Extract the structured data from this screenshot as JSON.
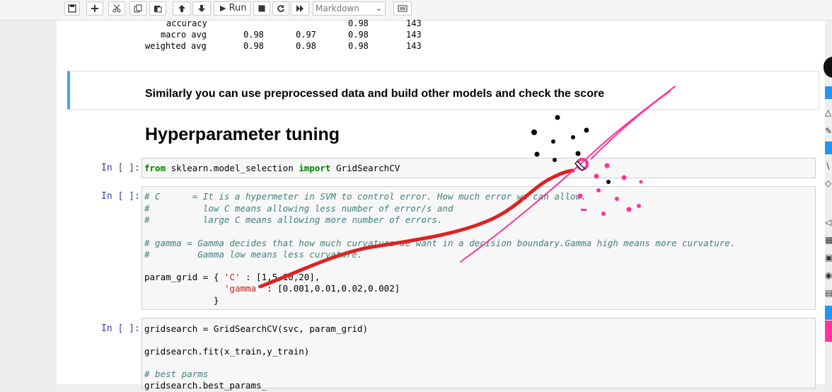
{
  "toolbar": {
    "buttons": [
      {
        "name": "save-icon"
      },
      {
        "name": "add-cell-icon"
      },
      {
        "name": "cut-icon"
      },
      {
        "name": "copy-icon"
      },
      {
        "name": "paste-icon"
      },
      {
        "name": "move-up-icon"
      },
      {
        "name": "move-down-icon"
      },
      {
        "name": "run-icon",
        "label": "Run"
      },
      {
        "name": "stop-icon"
      },
      {
        "name": "restart-icon"
      },
      {
        "name": "fast-forward-icon"
      },
      {
        "name": "keyboard-icon"
      }
    ],
    "run_label": "Run",
    "cell_type": "Markdown"
  },
  "report_rows": [
    {
      "label": "accuracy",
      "c1": "",
      "c2": "",
      "c3": "0.98",
      "c4": "143"
    },
    {
      "label": "macro avg",
      "c1": "0.98",
      "c2": "0.97",
      "c3": "0.98",
      "c4": "143"
    },
    {
      "label": "weighted avg",
      "c1": "0.98",
      "c2": "0.98",
      "c3": "0.98",
      "c4": "143"
    }
  ],
  "markdown_note": "Similarly you can use preprocessed data and build other models and check the score",
  "heading": "Hyperparameter tuning",
  "cells": [
    {
      "prompt": "In [ ]:"
    },
    {
      "prompt": "In [ ]:"
    },
    {
      "prompt": "In [ ]:"
    }
  ],
  "code": {
    "import_from": "from",
    "import_module": " sklearn.model_selection ",
    "import_kw": "import",
    "import_name": " GridSearchCV",
    "c_line1": "# C      = It is a hypermeter in SVM to control error. How much error we can allow.",
    "c_line2": "#          low C means allowing less number of error/s and",
    "c_line3": "#          large C means allowing more number of errors.",
    "gamma_line1": "# gamma = Gamma decides that how much curvature we want in a decision boundary.Gamma high means more curvature.",
    "gamma_line2": "#         Gamma low means less curvature.",
    "grid_line1_a": "param_grid = { ",
    "grid_line1_key": "'C'",
    "grid_line1_b": " : [1,5,10,20],",
    "grid_line2_pad": "               ",
    "grid_line2_key": "'gamma'",
    "grid_line2_b": " : [0.001,0.01,0.02,0.002]",
    "grid_line3": "             }",
    "gs_line1": "gridsearch = GridSearchCV(svc, param_grid)",
    "gs_line2": "gridsearch.fit(x_train,y_train)",
    "gs_line3": "# best parms",
    "gs_line4": "gridsearch.best_params_"
  },
  "colors": {
    "annotation_red": "#e02020",
    "annotation_pink": "#ff3399",
    "cell_border_accent": "#42a5f5"
  }
}
